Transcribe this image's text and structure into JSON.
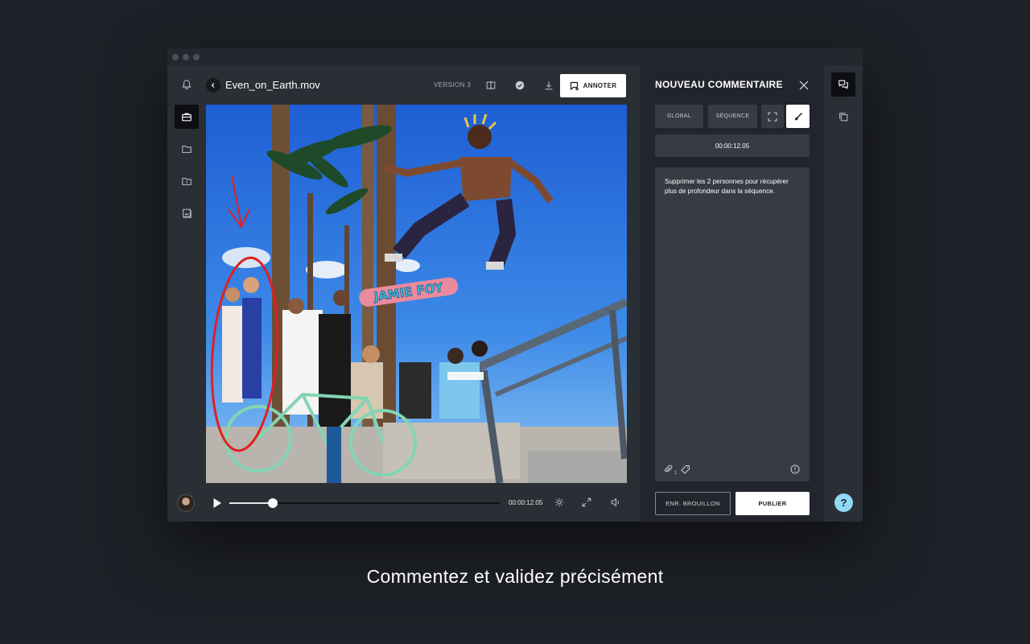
{
  "file": {
    "name": "Even_on_Earth.mov",
    "version": "VERSION 3"
  },
  "header": {
    "annotate_label": "ANNOTER"
  },
  "player": {
    "time": "00:00:12.05",
    "progress_fraction": 0.16
  },
  "comment_panel": {
    "title": "NOUVEAU COMMENTAIRE",
    "scope_tabs": [
      "GLOBAL",
      "SÉQUENCE"
    ],
    "timecode": "00:00:12.05",
    "text": "Supprimer les 2 personnes  pour récupérer plus de profondeur dans la séquence.",
    "attachment_count": "1",
    "draft_label": "ENR. BROUILLON",
    "publish_label": "PUBLIER"
  },
  "help_label": "?",
  "skate_text": "JAMIE FOY",
  "tagline": "Commentez et validez précisément",
  "colors": {
    "background": "#1e2127",
    "panel": "#22252b",
    "annotation": "#e02020",
    "help": "#8fd9f4"
  }
}
